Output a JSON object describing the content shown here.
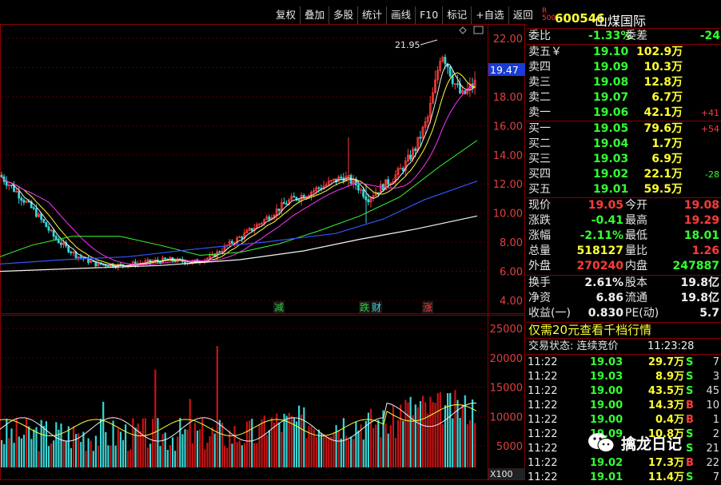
{
  "toolbar": {
    "buttons": [
      "复权",
      "叠加",
      "多股",
      "统计",
      "画线",
      "F10",
      "标记",
      "+自选",
      "返回"
    ]
  },
  "stock": {
    "code": "600546",
    "name": "山煤国际",
    "logo_top": "R",
    "logo_bottom": "500"
  },
  "chart": {
    "price_axis": [
      "22.00",
      "20.00",
      "18.00",
      "16.00",
      "14.00",
      "12.00",
      "10.00",
      "8.00",
      "6.00",
      "4.00"
    ],
    "volume_axis": [
      "25000",
      "20000",
      "15000",
      "10000",
      "5000"
    ],
    "current_price_tag": "19.47",
    "high_label": "21.95",
    "multiplier": "X100",
    "events": [
      {
        "text": "减",
        "color": "#2ecc40"
      },
      {
        "text": "跌",
        "color": "#2ecc40"
      },
      {
        "text": "财",
        "color": "#39d5d5"
      },
      {
        "text": "涨",
        "color": "#ff3b3b"
      }
    ]
  },
  "quote": {
    "webi_label": "委比",
    "webi": "-1.33%",
    "wecha_label": "委差",
    "wecha": "-24",
    "asks": [
      {
        "label": "卖五￥",
        "price": "19.10",
        "vol": "102.9万",
        "diff": ""
      },
      {
        "label": "卖四",
        "price": "19.09",
        "vol": "10.3万",
        "diff": ""
      },
      {
        "label": "卖三",
        "price": "19.08",
        "vol": "12.8万",
        "diff": ""
      },
      {
        "label": "卖二",
        "price": "19.07",
        "vol": "6.7万",
        "diff": ""
      },
      {
        "label": "卖一",
        "price": "19.06",
        "vol": "42.1万",
        "diff": "+41"
      }
    ],
    "bids": [
      {
        "label": "买一",
        "price": "19.05",
        "vol": "79.6万",
        "diff": "+54"
      },
      {
        "label": "买二",
        "price": "19.04",
        "vol": "1.7万",
        "diff": ""
      },
      {
        "label": "买三",
        "price": "19.03",
        "vol": "6.9万",
        "diff": ""
      },
      {
        "label": "买四",
        "price": "19.02",
        "vol": "22.1万",
        "diff": "-28"
      },
      {
        "label": "买五",
        "price": "19.01",
        "vol": "59.5万",
        "diff": ""
      }
    ],
    "stats": [
      {
        "l1": "现价",
        "v1": "19.05",
        "c1": "red",
        "l2": "今开",
        "v2": "19.08",
        "c2": "red"
      },
      {
        "l1": "涨跌",
        "v1": "-0.41",
        "c1": "green",
        "l2": "最高",
        "v2": "19.29",
        "c2": "red"
      },
      {
        "l1": "涨幅",
        "v1": "-2.11%",
        "c1": "green",
        "l2": "最低",
        "v2": "18.01",
        "c2": "green"
      },
      {
        "l1": "总量",
        "v1": "518127",
        "c1": "yellow",
        "l2": "量比",
        "v2": "1.26",
        "c2": "red"
      },
      {
        "l1": "外盘",
        "v1": "270240",
        "c1": "red",
        "l2": "内盘",
        "v2": "247887",
        "c2": "green"
      }
    ],
    "fund": [
      {
        "l1": "换手",
        "v1": "2.61%",
        "l2": "股本",
        "v2": "19.8亿"
      },
      {
        "l1": "净资",
        "v1": "6.86",
        "l2": "流通",
        "v2": "19.8亿"
      },
      {
        "l1": "收益(一)",
        "v1": "0.830",
        "l2": "PE(动)",
        "v2": "5.7"
      }
    ],
    "promo": "仅需20元查看千档行情",
    "status_label": "交易状态: 连续竞价",
    "status_time": "11:23:28"
  },
  "trades": [
    {
      "t": "11:22",
      "p": "19.03",
      "v": "29.7万",
      "bs": "S",
      "n": "7"
    },
    {
      "t": "11:22",
      "p": "19.03",
      "v": "8.9万",
      "bs": "S",
      "n": "3"
    },
    {
      "t": "11:22",
      "p": "19.00",
      "v": "43.5万",
      "bs": "S",
      "n": "45"
    },
    {
      "t": "11:22",
      "p": "19.00",
      "v": "14.3万",
      "bs": "B",
      "n": "10"
    },
    {
      "t": "11:22",
      "p": "19.00",
      "v": "0.4万",
      "bs": "B",
      "n": "1"
    },
    {
      "t": "11:22",
      "p": "19.09",
      "v": "10.8万",
      "bs": "S",
      "n": "2"
    },
    {
      "t": "11:22",
      "p": "",
      "v": "",
      "bs": "S",
      "n": "21"
    },
    {
      "t": "11:22",
      "p": "19.02",
      "v": "17.3万",
      "bs": "B",
      "n": "22"
    },
    {
      "t": "11:22",
      "p": "19.01",
      "v": "11.4万",
      "bs": "S",
      "n": "7"
    }
  ],
  "watermark": {
    "text": "擒龙日记"
  }
}
